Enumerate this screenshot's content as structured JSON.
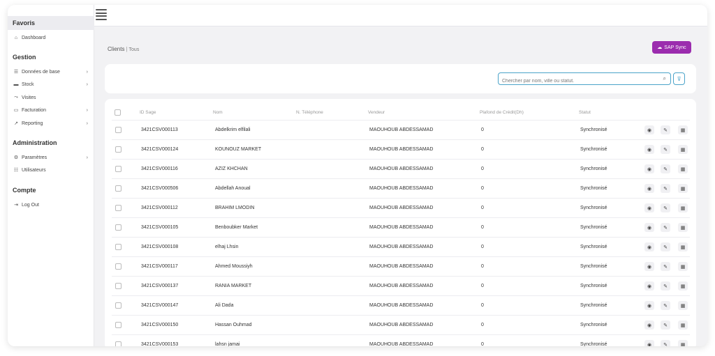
{
  "sidebar": {
    "favoris_title": "Favoris",
    "dashboard": {
      "label": "Dashboard",
      "icon": "home-icon"
    },
    "gestion_title": "Gestion",
    "gestion_items": [
      {
        "label": "Données de base",
        "icon": "list-icon",
        "has_submenu": true
      },
      {
        "label": "Stock",
        "icon": "stock-icon",
        "has_submenu": true
      },
      {
        "label": "Visites",
        "icon": "route-icon",
        "has_submenu": false
      },
      {
        "label": "Facturation",
        "icon": "invoice-icon",
        "has_submenu": true
      },
      {
        "label": "Reporting",
        "icon": "chart-icon",
        "has_submenu": true
      }
    ],
    "administration_title": "Administration",
    "administration_items": [
      {
        "label": "Paramètres",
        "icon": "gear-icon",
        "has_submenu": true
      },
      {
        "label": "Utilisateurs",
        "icon": "users-icon",
        "has_submenu": false
      }
    ],
    "compte_title": "Compte",
    "logout": {
      "label": "Log Out",
      "icon": "logout-icon"
    }
  },
  "breadcrumb": {
    "title": "Clients",
    "sub": "Tous"
  },
  "sap_button": {
    "label": "SAP Sync",
    "icon": "cloud-sync-icon",
    "color": "#9b2cae"
  },
  "search": {
    "placeholder": "Chercher par nom, ville ou statut."
  },
  "table": {
    "columns": [
      "ID Sage",
      "Nom",
      "N. Téléphone",
      "Vendeur",
      "Plafond de Crédit(Dh)",
      "Statut"
    ],
    "rows": [
      {
        "id": "3421CSV000113",
        "nom": "Abdelkrim elfilali",
        "tel": "",
        "vendeur": "MAOUHOUB ABDESSAMAD",
        "plafond": "0",
        "statut": "Synchronisé"
      },
      {
        "id": "3421CSV000124",
        "nom": "KOUNOUZ MARKET",
        "tel": "",
        "vendeur": "MAOUHOUB ABDESSAMAD",
        "plafond": "0",
        "statut": "Synchronisé"
      },
      {
        "id": "3421CSV000116",
        "nom": "AZIZ KHCHAN",
        "tel": "",
        "vendeur": "MAOUHOUB ABDESSAMAD",
        "plafond": "0",
        "statut": "Synchronisé"
      },
      {
        "id": "3421CSV000506",
        "nom": "Abdellah Anoual",
        "tel": "",
        "vendeur": "MAOUHOUB ABDESSAMAD",
        "plafond": "0",
        "statut": "Synchronisé"
      },
      {
        "id": "3421CSV000112",
        "nom": "BRAHIM LMODIN",
        "tel": "",
        "vendeur": "MAOUHOUB ABDESSAMAD",
        "plafond": "0",
        "statut": "Synchronisé"
      },
      {
        "id": "3421CSV000105",
        "nom": "Benboubker Market",
        "tel": "",
        "vendeur": "MAOUHOUB ABDESSAMAD",
        "plafond": "0",
        "statut": "Synchronisé"
      },
      {
        "id": "3421CSV000108",
        "nom": "elhaj Lhsin",
        "tel": "",
        "vendeur": "MAOUHOUB ABDESSAMAD",
        "plafond": "0",
        "statut": "Synchronisé"
      },
      {
        "id": "3421CSV000117",
        "nom": "Ahmed Moussiyh",
        "tel": "",
        "vendeur": "MAOUHOUB ABDESSAMAD",
        "plafond": "0",
        "statut": "Synchronisé"
      },
      {
        "id": "3421CSV000137",
        "nom": "RANIA MARKET",
        "tel": "",
        "vendeur": "MAOUHOUB ABDESSAMAD",
        "plafond": "0",
        "statut": "Synchronisé"
      },
      {
        "id": "3421CSV000147",
        "nom": "Ali Dada",
        "tel": "",
        "vendeur": "MAOUHOUB ABDESSAMAD",
        "plafond": "0",
        "statut": "Synchronisé"
      },
      {
        "id": "3421CSV000150",
        "nom": "Hassan Ouhmad",
        "tel": "",
        "vendeur": "MAOUHOUB ABDESSAMAD",
        "plafond": "0",
        "statut": "Synchronisé"
      },
      {
        "id": "3421CSV000153",
        "nom": "lahsn jamai",
        "tel": "",
        "vendeur": "MAOUHOUB ABDESSAMAD",
        "plafond": "0",
        "statut": "Synchronisé"
      }
    ],
    "actions": [
      {
        "name": "view",
        "icon": "eye-icon"
      },
      {
        "name": "edit",
        "icon": "pencil-icon"
      },
      {
        "name": "more",
        "icon": "grid-icon"
      }
    ]
  }
}
